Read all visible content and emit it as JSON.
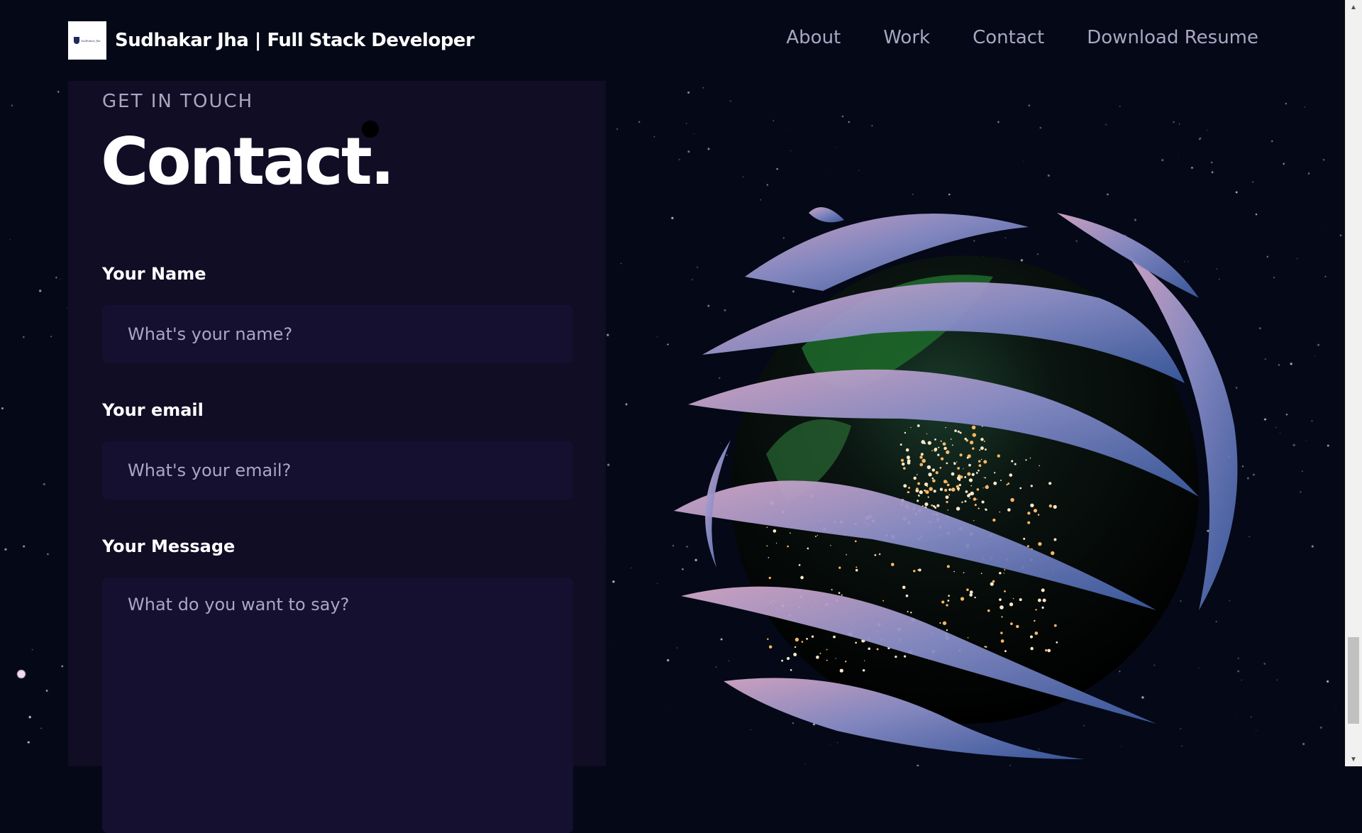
{
  "colors": {
    "background": "#050816",
    "card": "#100d25",
    "input": "#151030",
    "secondary_text": "#aaa6c3",
    "accent_blue": "#3a5aa0",
    "accent_pink": "#c8a0c8"
  },
  "header": {
    "logo_text": "Sudhakar Jha",
    "brand": "Sudhakar Jha | Full Stack Developer",
    "nav": [
      {
        "label": "About"
      },
      {
        "label": "Work"
      },
      {
        "label": "Contact"
      },
      {
        "label": "Download Resume"
      }
    ]
  },
  "contact": {
    "subhead": "GET IN TOUCH",
    "title": "Contact.",
    "name_label": "Your Name",
    "name_placeholder": "What's your name?",
    "email_label": "Your email",
    "email_placeholder": "What's your email?",
    "message_label": "Your Message",
    "message_placeholder": "What do you want to say?"
  },
  "icons": {
    "logo": "shield-logo-icon",
    "scroll_up": "arrow-up-icon",
    "scroll_down": "arrow-down-icon"
  }
}
